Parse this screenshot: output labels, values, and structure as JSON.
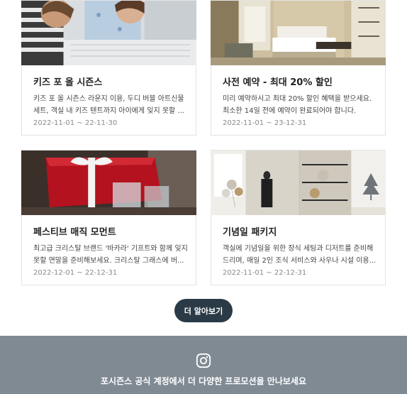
{
  "promotions": [
    {
      "title": "키즈 포 올 시즌스",
      "desc_lines": [
        "키즈 포 올 시즌스 라운지 이용, 두디 버블 아트신물",
        "세트, 객실 내 키즈 텐트까지 아이에게 잊지 못할 ..."
      ],
      "date": "2022-11-01 ~ 22-11-30"
    },
    {
      "title": "사전 예약 - 최대 20% 할인",
      "desc_lines": [
        "미리 예약하시고 최대 20% 할인 혜택을 받으세요.",
        "최소한 14일 전에 예약이 완료되어야 합니다."
      ],
      "date": "2022-11-01 ~ 23-12-31"
    },
    {
      "title": "페스티브 매직 모먼트",
      "desc_lines": [
        "최고급 크리스탈 브랜드 '바카라' 기프트와 함께 잊지",
        "못할 연말을 준비해보세요. 크리스탈 그래스에 버..."
      ],
      "date": "2022-12-01 ~ 22-12-31"
    },
    {
      "title": "기념일 패키지",
      "desc_lines": [
        "객실에 기념일을 위한 장식 세팅과 디저트를 준비해",
        "드리며, 매일 2인 조식 서비스와 사우나 시설 이용..."
      ],
      "date": "2022-11-01 ~ 22-12-31"
    }
  ],
  "more_button": "더 알아보기",
  "footer": {
    "icon": "instagram-icon",
    "text": "포시즌스 공식 계정에서 더 다양한 프로모션을 만나보세요"
  },
  "colors": {
    "button_bg": "#2a3b47",
    "footer_bg": "#7f8a93",
    "card_border": "#e3e3e3",
    "date_text": "#8a8a8a"
  }
}
